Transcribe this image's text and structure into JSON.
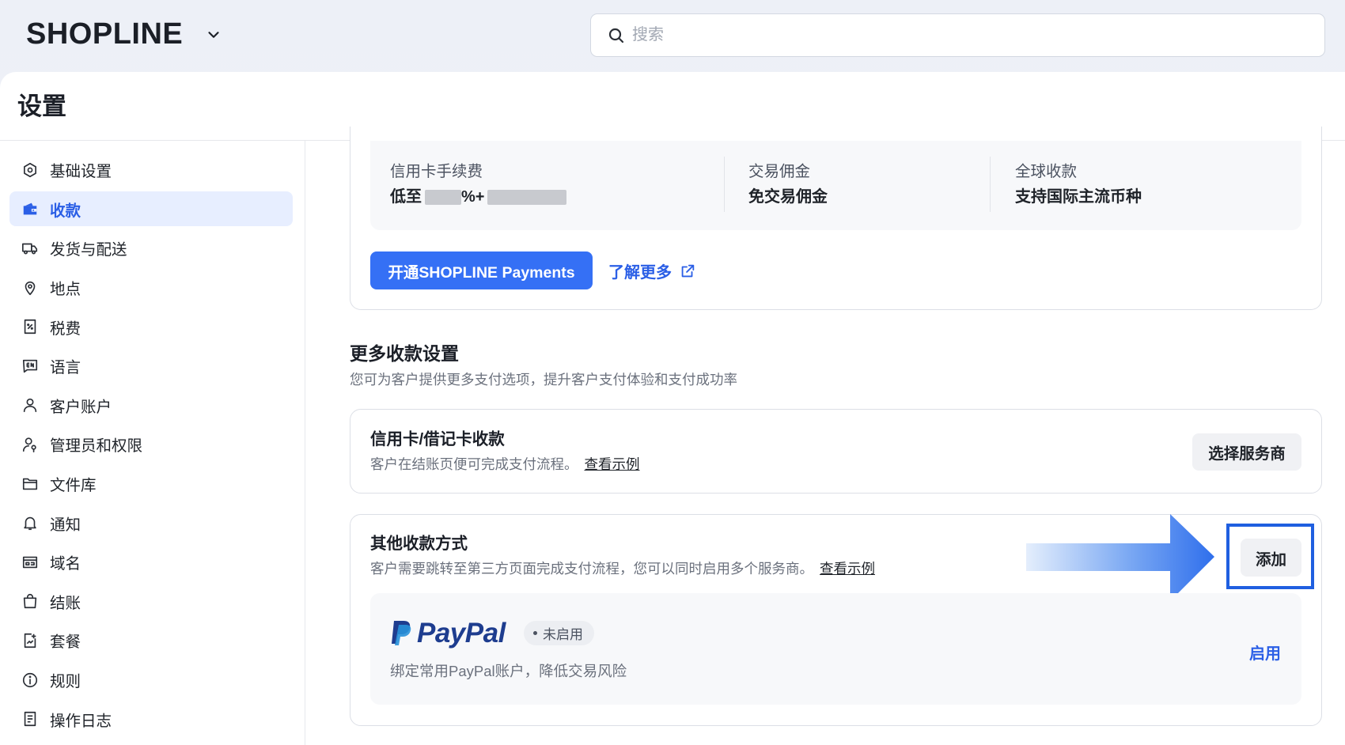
{
  "app": {
    "logo": "SHOPLINE"
  },
  "search": {
    "placeholder": "搜索"
  },
  "page": {
    "title": "设置"
  },
  "sidebar": {
    "items": [
      {
        "label": "基础设置",
        "icon": "hexagon-settings-icon"
      },
      {
        "label": "收款",
        "icon": "wallet-icon",
        "active": true
      },
      {
        "label": "发货与配送",
        "icon": "truck-icon"
      },
      {
        "label": "地点",
        "icon": "location-pin-icon"
      },
      {
        "label": "税费",
        "icon": "tax-receipt-icon"
      },
      {
        "label": "语言",
        "icon": "language-icon"
      },
      {
        "label": "客户账户",
        "icon": "user-icon"
      },
      {
        "label": "管理员和权限",
        "icon": "user-key-icon"
      },
      {
        "label": "文件库",
        "icon": "folder-icon"
      },
      {
        "label": "通知",
        "icon": "bell-icon"
      },
      {
        "label": "域名",
        "icon": "domain-icon"
      },
      {
        "label": "结账",
        "icon": "shopping-bag-icon"
      },
      {
        "label": "套餐",
        "icon": "plan-icon"
      },
      {
        "label": "规则",
        "icon": "info-icon"
      },
      {
        "label": "操作日志",
        "icon": "log-icon"
      }
    ]
  },
  "payments_card": {
    "stats": [
      {
        "label": "信用卡手续费",
        "value_prefix": "低至",
        "value_mid": "%+"
      },
      {
        "label": "交易佣金",
        "value": "免交易佣金"
      },
      {
        "label": "全球收款",
        "value": "支持国际主流币种"
      }
    ],
    "activate_button": "开通SHOPLINE Payments",
    "learn_more": "了解更多"
  },
  "more_settings": {
    "title": "更多收款设置",
    "subtitle": "您可为客户提供更多支付选项，提升客户支付体验和支付成功率"
  },
  "card_payments": {
    "title": "信用卡/借记卡收款",
    "desc": "客户在结账页便可完成支付流程。",
    "example_link": "查看示例",
    "button": "选择服务商"
  },
  "other_payments": {
    "title": "其他收款方式",
    "desc": "客户需要跳转至第三方页面完成支付流程，您可以同时启用多个服务商。",
    "example_link": "查看示例",
    "button": "添加",
    "paypal": {
      "name": "PayPal",
      "status": "未启用",
      "desc": "绑定常用PayPal账户，降低交易风险",
      "enable": "启用"
    }
  },
  "colors": {
    "accent": "#3570f5",
    "link": "#2b5fe6",
    "active_bg": "#e7eeff",
    "highlight_border": "#1f5fe0"
  }
}
